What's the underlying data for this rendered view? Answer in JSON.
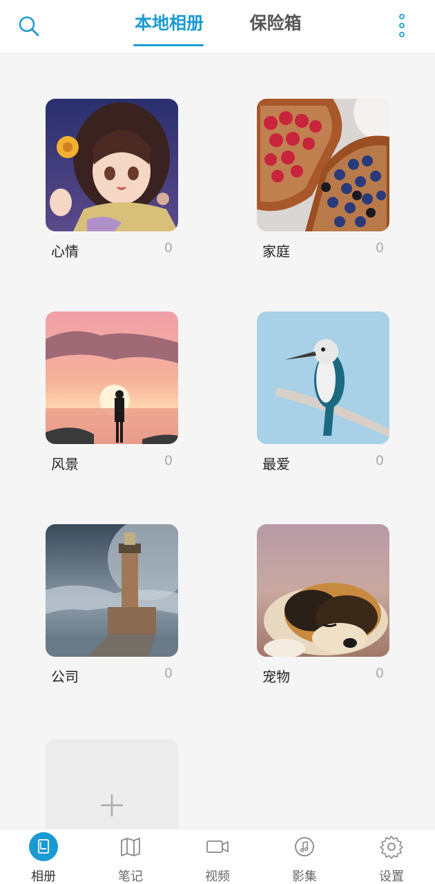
{
  "header": {
    "tabs": [
      {
        "label": "本地相册",
        "active": true
      },
      {
        "label": "保险箱",
        "active": false
      }
    ]
  },
  "albums": [
    {
      "name": "心情",
      "count": "0"
    },
    {
      "name": "家庭",
      "count": "0"
    },
    {
      "name": "风景",
      "count": "0"
    },
    {
      "name": "最爱",
      "count": "0"
    },
    {
      "name": "公司",
      "count": "0"
    },
    {
      "name": "宠物",
      "count": "0"
    }
  ],
  "bottom_nav": [
    {
      "label": "相册",
      "icon": "album-icon",
      "active": true
    },
    {
      "label": "笔记",
      "icon": "map-icon",
      "active": false
    },
    {
      "label": "视频",
      "icon": "video-icon",
      "active": false
    },
    {
      "label": "影集",
      "icon": "music-icon",
      "active": false
    },
    {
      "label": "设置",
      "icon": "gear-icon",
      "active": false
    }
  ],
  "colors": {
    "accent": "#1a9ad2",
    "background": "#f5f5f5"
  }
}
